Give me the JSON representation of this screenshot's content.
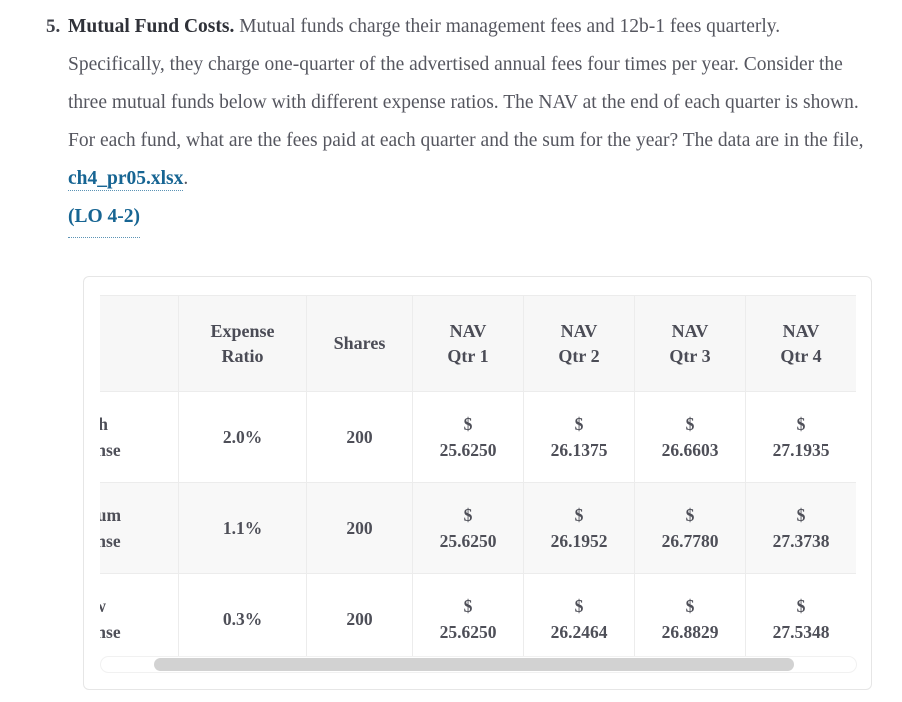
{
  "question": {
    "number": "5.",
    "title": "Mutual Fund Costs.",
    "text_before_link": " Mutual funds charge their management fees and 12b-1 fees quarterly. Specifically, they charge one-quarter of the advertised annual fees four times per year. Consider the three mutual funds below with different expense ratios. The NAV at the end of each quarter is shown. For each fund, what are the fees paid at each quarter and the sum for the year? The data are in the file, ",
    "file_link": "ch4_pr05.xlsx",
    "text_after_link": ".",
    "lo_link": "(LO 4-2)",
    "link_color": "#176593"
  },
  "table": {
    "headers": [
      "",
      "Expense Ratio",
      "Shares",
      "NAV Qtr 1",
      "NAV Qtr 2",
      "NAV Qtr 3",
      "NAV Qtr 4"
    ],
    "header_lines": [
      [
        "",
        ""
      ],
      [
        "Expense",
        "Ratio"
      ],
      [
        "Shares",
        ""
      ],
      [
        "NAV",
        "Qtr 1"
      ],
      [
        "NAV",
        "Qtr 2"
      ],
      [
        "NAV",
        "Qtr 3"
      ],
      [
        "NAV",
        "Qtr 4"
      ]
    ],
    "rows": [
      {
        "name_lines": [
          "High",
          "Expense"
        ],
        "expense_ratio": "2.0%",
        "shares": "200",
        "nav": [
          {
            "symbol": "$",
            "value": "25.6250"
          },
          {
            "symbol": "$",
            "value": "26.1375"
          },
          {
            "symbol": "$",
            "value": "26.6603"
          },
          {
            "symbol": "$",
            "value": "27.1935"
          }
        ]
      },
      {
        "name_lines": [
          "Medium",
          "Expense"
        ],
        "expense_ratio": "1.1%",
        "shares": "200",
        "nav": [
          {
            "symbol": "$",
            "value": "25.6250"
          },
          {
            "symbol": "$",
            "value": "26.1952"
          },
          {
            "symbol": "$",
            "value": "26.7780"
          },
          {
            "symbol": "$",
            "value": "27.3738"
          }
        ]
      },
      {
        "name_lines": [
          "Low",
          "Expense"
        ],
        "expense_ratio": "0.3%",
        "shares": "200",
        "nav": [
          {
            "symbol": "$",
            "value": "25.6250"
          },
          {
            "symbol": "$",
            "value": "26.2464"
          },
          {
            "symbol": "$",
            "value": "26.8829"
          },
          {
            "symbol": "$",
            "value": "27.5348"
          }
        ]
      }
    ]
  },
  "scrollbar": {
    "orientation": "horizontal",
    "thumb_position_percent": 7,
    "thumb_width_percent": 85
  }
}
